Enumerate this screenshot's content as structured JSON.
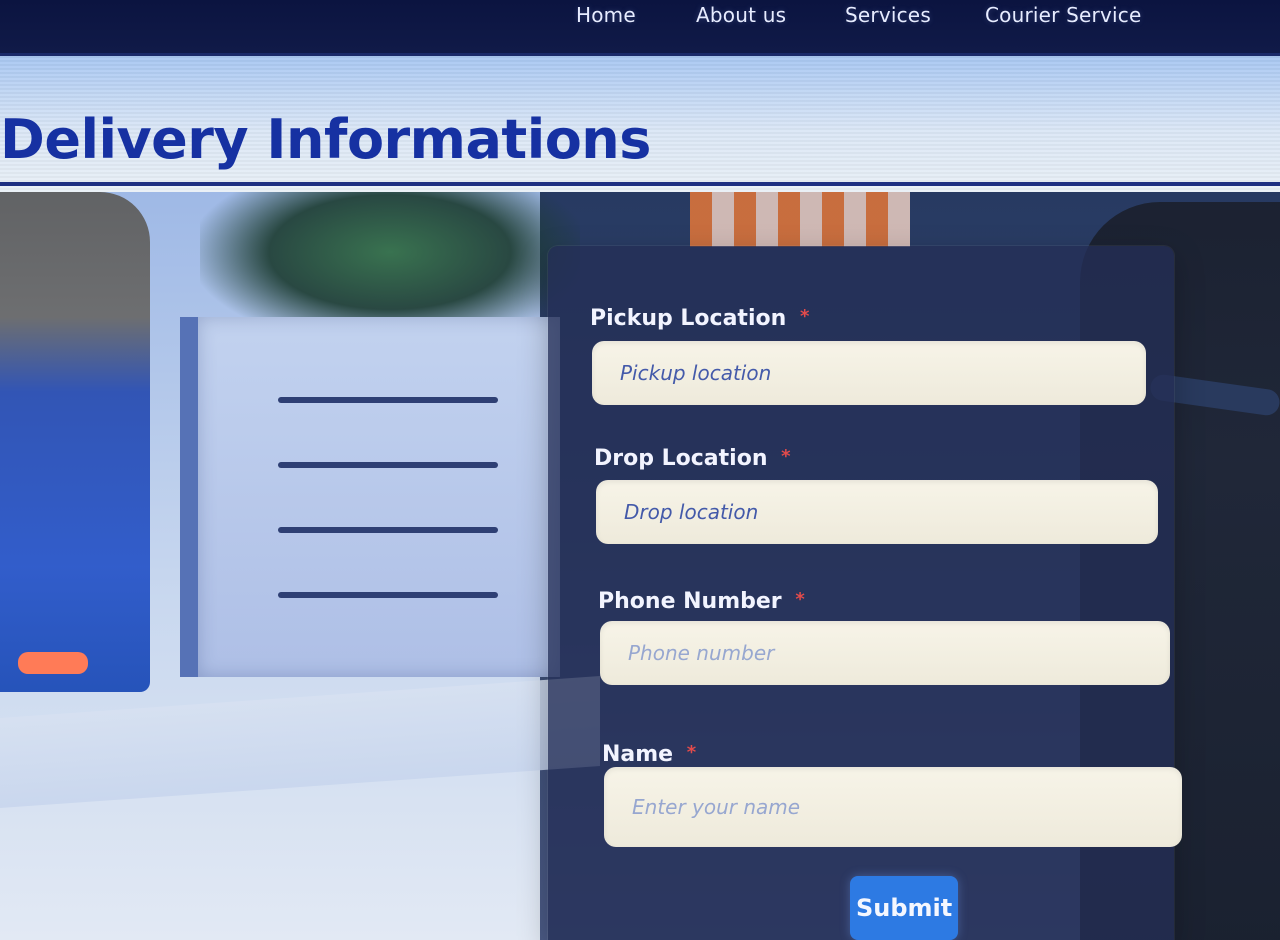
{
  "nav": {
    "links": [
      {
        "label": "Home"
      },
      {
        "label": "About us"
      },
      {
        "label": "Services"
      },
      {
        "label": "Courier Service"
      }
    ]
  },
  "page": {
    "title": "Delivery Informations"
  },
  "form": {
    "fields": [
      {
        "label": "Pickup Location",
        "required_mark": "*",
        "placeholder": "Pickup location",
        "value": ""
      },
      {
        "label": "Drop Location",
        "required_mark": "*",
        "placeholder": "Drop location",
        "value": ""
      },
      {
        "label": "Phone Number",
        "required_mark": "*",
        "placeholder": "Phone number",
        "value": ""
      },
      {
        "label": "Name",
        "required_mark": "*",
        "placeholder": "Enter your name",
        "value": ""
      }
    ],
    "submit_label": "Submit"
  },
  "colors": {
    "nav_bg": "#0b1440",
    "title_text": "#1631a2",
    "panel_bg": "#242e56",
    "input_bg": "#f7f4e8",
    "required": "#e34b4b",
    "submit_bg": "#2d7ae3"
  }
}
